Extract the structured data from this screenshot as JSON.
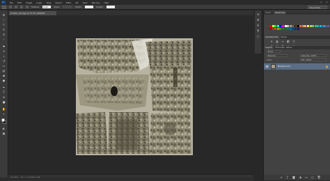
{
  "app": {
    "logo_text": "Ps",
    "menus": [
      "File",
      "Edit",
      "Image",
      "Layer",
      "Type",
      "Select",
      "Filter",
      "3D",
      "View",
      "Window",
      "Help"
    ]
  },
  "window_controls": {
    "minimize": "–",
    "maximize": "□",
    "close": "✕"
  },
  "options_bar": {
    "feather_label": "Feather:",
    "feather_value": "0 px",
    "style_label": "Style:",
    "width_label": "Width:",
    "height_label": "Height:",
    "workspace": "Essentials"
  },
  "document": {
    "tab_title": "Soldier_tex.tga @ 33.3% (RGB/8)",
    "zoom": "33.33%",
    "info": "Doc: 12.0M/12.0M"
  },
  "panels": {
    "top_tabs": [
      "Color",
      "Swatches"
    ],
    "mid_tabs": [
      "Adjustments",
      "Styles"
    ],
    "layer_tabs": [
      "Layers",
      "Channels",
      "Paths"
    ],
    "kind_label": "Kind",
    "blend_mode": "Normal",
    "opacity_label": "Opacity: 100%",
    "lock_label": "Lock:",
    "fill_label": "Fill: 100%"
  },
  "layers": [
    {
      "name": "Background",
      "locked": true
    }
  ],
  "colors": {
    "foreground": "#ffffff",
    "background": "#000000",
    "selected_layer": "#5a6d84"
  },
  "icons": {
    "tools": [
      "move-icon",
      "marquee-icon",
      "lasso-icon",
      "quick-select-icon",
      "crop-icon",
      "eyedropper-icon",
      "healing-icon",
      "brush-icon",
      "clone-stamp-icon",
      "history-brush-icon",
      "eraser-icon",
      "gradient-icon",
      "blur-icon",
      "dodge-icon",
      "pen-icon",
      "type-icon",
      "path-select-icon",
      "rectangle-icon",
      "hand-icon",
      "zoom-icon"
    ],
    "panel_strip": [
      "history-icon",
      "properties-icon",
      "character-icon",
      "paragraph-icon",
      "info-icon"
    ],
    "layers_footer": [
      "link-icon",
      "fx-icon",
      "mask-icon",
      "adjustment-layer-icon",
      "group-icon",
      "new-layer-icon",
      "trash-icon"
    ]
  }
}
